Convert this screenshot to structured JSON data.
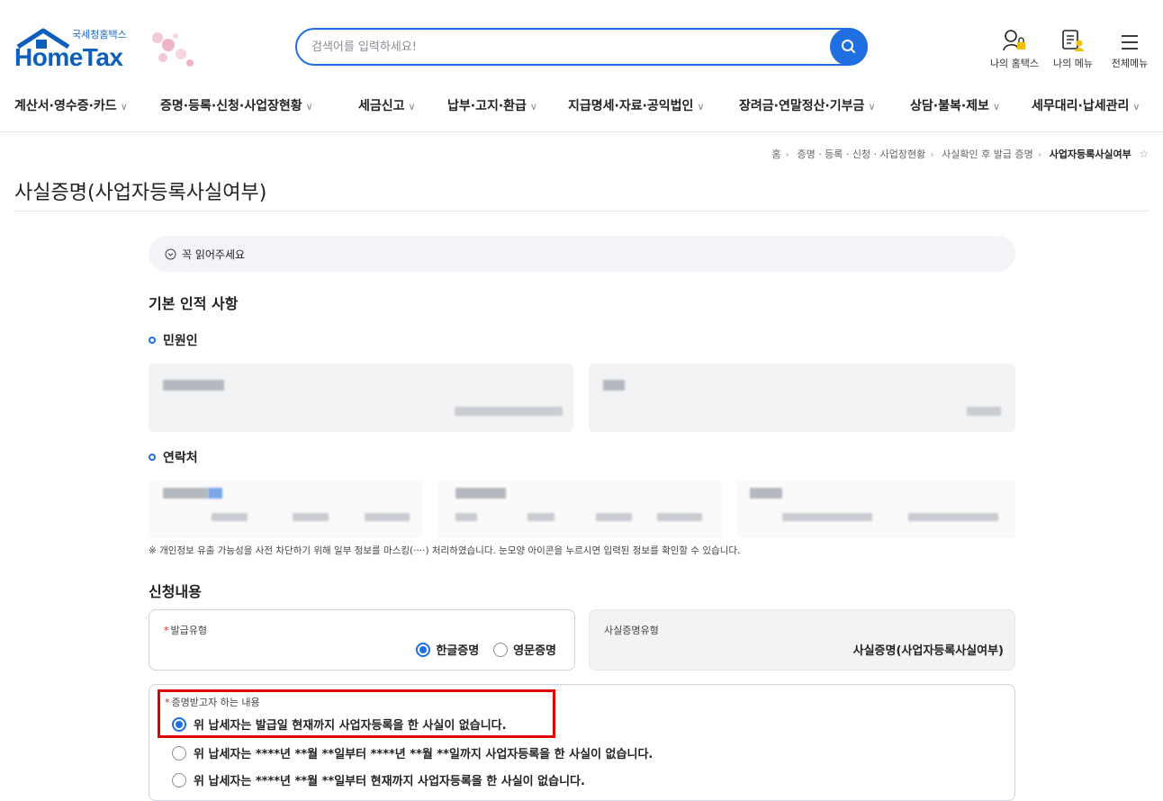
{
  "header": {
    "logo_org": "국세청홈택스",
    "logo_brand": "HomeTax",
    "search_placeholder": "검색어를 입력하세요!",
    "utils": [
      {
        "label": "나의 홈택스",
        "icon": "user-lock-icon"
      },
      {
        "label": "나의 메뉴",
        "icon": "my-menu-icon"
      },
      {
        "label": "전체메뉴",
        "icon": "hamburger-menu-icon"
      }
    ]
  },
  "gnb": [
    "계산서·영수증·카드",
    "증명·등록·신청·사업장현황",
    "세금신고",
    "납부·고지·환급",
    "지급명세·자료·공익법인",
    "장려금·연말정산·기부금",
    "상담·불복·제보",
    "세무대리·납세관리"
  ],
  "breadcrumb": {
    "items": [
      "홈",
      "증명 · 등록 · 신청 · 사업장현황",
      "사실확인 후 발급 증명"
    ],
    "current": "사업자등록사실여부"
  },
  "page_title": "사실증명(사업자등록사실여부)",
  "notice": "꼭 읽어주세요",
  "basic_section": {
    "title": "기본 인적 사항",
    "applicant_label": "민원인",
    "contact_label": "연락처"
  },
  "privacy_note": "※ 개인정보 유출 가능성을 사전 차단하기 위해 일부 정보를 마스킹(····) 처리하였습니다. 눈모양 아이콘을 누르시면 입력된 정보를 확인할 수 있습니다.",
  "application": {
    "title": "신청내용",
    "issue_type": {
      "label": "발급유형",
      "options": [
        {
          "label": "한글증명",
          "selected": true
        },
        {
          "label": "영문증명",
          "selected": false
        }
      ]
    },
    "cert_type": {
      "label": "사실증명유형",
      "value": "사실증명(사업자등록사실여부)"
    },
    "content": {
      "label": "증명받고자 하는 내용",
      "options": [
        {
          "label": "위 납세자는 발급일 현재까지 사업자등록을 한 사실이 없습니다.",
          "selected": true
        },
        {
          "label": "위 납세자는 ****년 **월 **일부터 ****년 **월 **일까지 사업자등록을 한 사실이 없습니다.",
          "selected": false
        },
        {
          "label": "위 납세자는 ****년 **월 **일부터 현재까지 사업자등록을 한 사실이 없습니다.",
          "selected": false
        }
      ]
    }
  },
  "colors": {
    "accent": "#1f6fe0",
    "highlight": "#e00000",
    "required": "#e02222"
  }
}
